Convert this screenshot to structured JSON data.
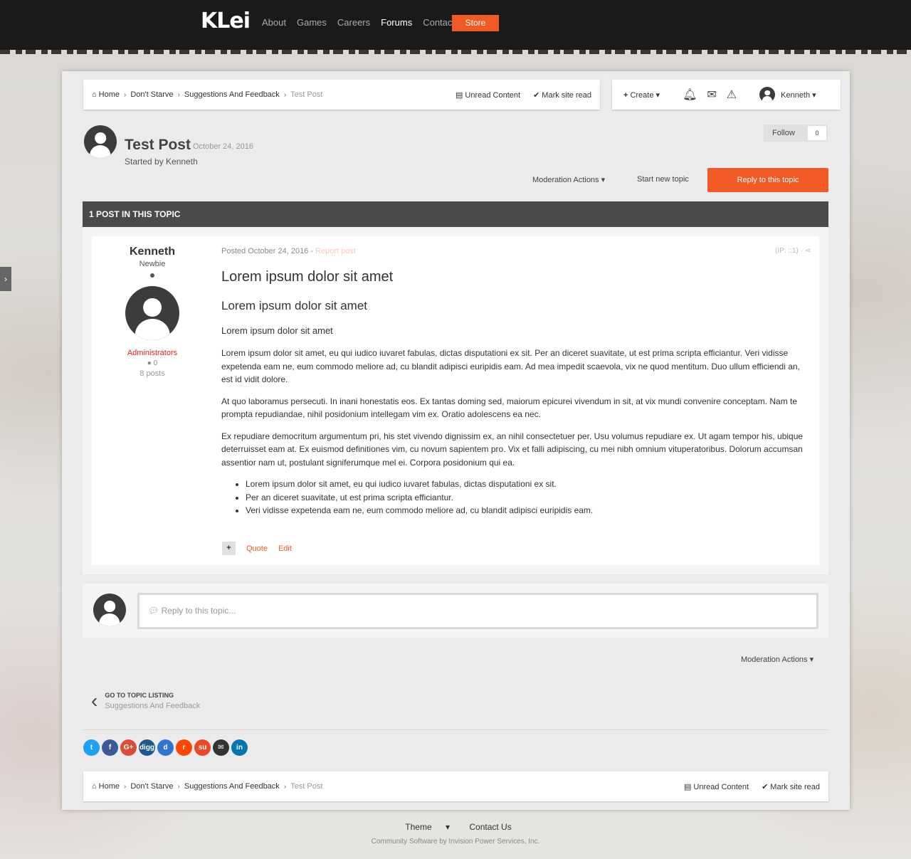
{
  "brand": {
    "logo": "KLei",
    "accent": "#f15a24"
  },
  "topnav": {
    "items": [
      "About",
      "Games",
      "Careers",
      "Forums",
      "Contact"
    ],
    "active": "Forums",
    "store": "Store"
  },
  "breadcrumb": {
    "home": "Home",
    "items": [
      "Don't Starve",
      "Suggestions And Feedback"
    ],
    "current": "Test Post"
  },
  "quicklinks": {
    "unread": "Unread Content",
    "mark_read": "Mark site read"
  },
  "userbar": {
    "create": "Create",
    "username": "Kenneth"
  },
  "topic": {
    "title": "Test Post",
    "date": "October 24, 2016",
    "started_by": "Started by Kenneth",
    "follow_label": "Follow",
    "follow_count": "0",
    "moderation": "Moderation Actions",
    "start_new": "Start new topic",
    "reply": "Reply to this topic",
    "post_count_header": "1 POST IN THIS TOPIC"
  },
  "post": {
    "author": {
      "name": "Kenneth",
      "rank": "Newbie",
      "group": "Administrators",
      "reputation": "0",
      "posts": "8 posts"
    },
    "meta": "Posted October 24, 2016",
    "report": "Report post",
    "ip": "(IP: ::1)",
    "h1": "Lorem ipsum dolor sit amet",
    "h2": "Lorem ipsum dolor sit amet",
    "h3": "Lorem ipsum dolor sit amet",
    "paragraphs": [
      "Lorem ipsum dolor sit amet, eu qui iudico iuvaret fabulas, dictas disputationi ex sit. Per an diceret suavitate, ut est prima scripta efficiantur. Veri vidisse expetenda eam ne, eum commodo meliore ad, cu blandit adipisci euripidis eam. Ad mea impedit scaevola, vix ne quod mentitum. Duo ullum efficiendi an, est id vidit dolore.",
      "At quo laboramus persecuti. In inani honestatis eos. Ex tantas doming sed, maiorum epicurei vivendum in sit, at vix mundi convenire conceptam. Nam te prompta repudiandae, nihil posidonium intellegam vim ex. Oratio adolescens ea nec.",
      "Ex repudiare democritum argumentum pri, his stet vivendo dignissim ex, an nihil consectetuer per. Usu volumus repudiare ex. Ut agam tempor his, ubique deterruisset eam at. Ex euismod definitiones vim, cu novum sapientem pro. Vix et falli adipiscing, cu mei nibh omnium vituperatoribus. Dolorum accumsan assentior nam ut, postulant signiferumque mel ei. Corpora posidonium qui ea."
    ],
    "list": [
      "Lorem ipsum dolor sit amet, eu qui iudico iuvaret fabulas, dictas disputationi ex sit.",
      "Per an diceret suavitate, ut est prima scripta efficiantur.",
      "Veri vidisse expetenda eam ne, eum commodo meliore ad, cu blandit adipisci euripidis eam."
    ],
    "actions": {
      "plus": "+",
      "quote": "Quote",
      "edit": "Edit"
    }
  },
  "reply_box": {
    "placeholder": "Reply to this topic..."
  },
  "goto": {
    "label": "GO TO TOPIC LISTING",
    "forum": "Suggestions And Feedback"
  },
  "share_icons": [
    "twitter-icon",
    "facebook-icon",
    "google-plus-icon",
    "digg-icon",
    "delicious-icon",
    "reddit-icon",
    "stumbleupon-icon",
    "email-icon",
    "linkedin-icon"
  ],
  "share_glyphs": [
    "t",
    "f",
    "G+",
    "digg",
    "d",
    "r",
    "su",
    "✉",
    "in"
  ],
  "share_colors": [
    "#1da1f2",
    "#3b5998",
    "#dd4b39",
    "#1b5891",
    "#3274d1",
    "#ff4500",
    "#eb4924",
    "#333333",
    "#0077b5"
  ],
  "footer": {
    "theme": "Theme",
    "contact": "Contact Us",
    "copyright": "Community Software by Invision Power Services, Inc."
  }
}
